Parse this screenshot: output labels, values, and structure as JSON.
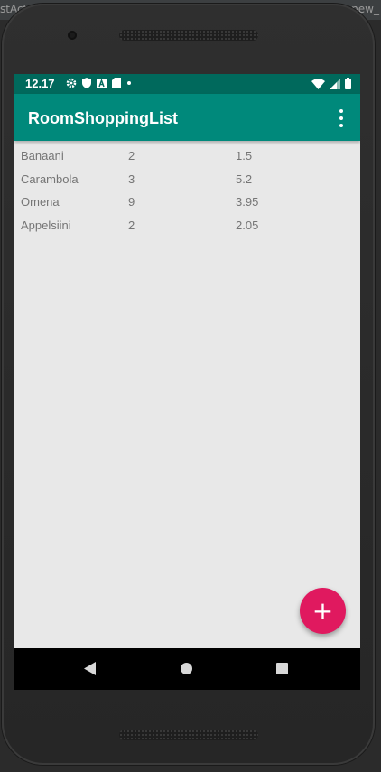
{
  "ide": {
    "left_fragment": "stAct",
    "right_fragment": "new_"
  },
  "status_bar": {
    "time": "12.17",
    "left_icons": [
      "gear-icon",
      "shield-icon",
      "notification-a-icon",
      "sd-card-icon",
      "dot-icon"
    ],
    "right_icons": [
      "wifi-icon",
      "cell-signal-icon",
      "battery-icon"
    ]
  },
  "app_bar": {
    "title": "RoomShoppingList",
    "menu_icon": "more-vert-icon"
  },
  "shopping_list": {
    "rows": [
      {
        "name": "Banaani",
        "qty": "2",
        "price": "1.5"
      },
      {
        "name": "Carambola",
        "qty": "3",
        "price": "5.2"
      },
      {
        "name": "Omena",
        "qty": "9",
        "price": "3.95"
      },
      {
        "name": "Appelsiini",
        "qty": "2",
        "price": "2.05"
      }
    ]
  },
  "fab": {
    "label": "+",
    "icon": "plus-icon"
  },
  "nav_bar": {
    "icons": [
      "back-icon",
      "home-icon",
      "recents-icon"
    ]
  },
  "colors": {
    "status_bar": "#00695c",
    "app_bar": "#00897b",
    "fab": "#e0195f",
    "background": "#e8e8e8",
    "text_secondary": "#757575"
  }
}
